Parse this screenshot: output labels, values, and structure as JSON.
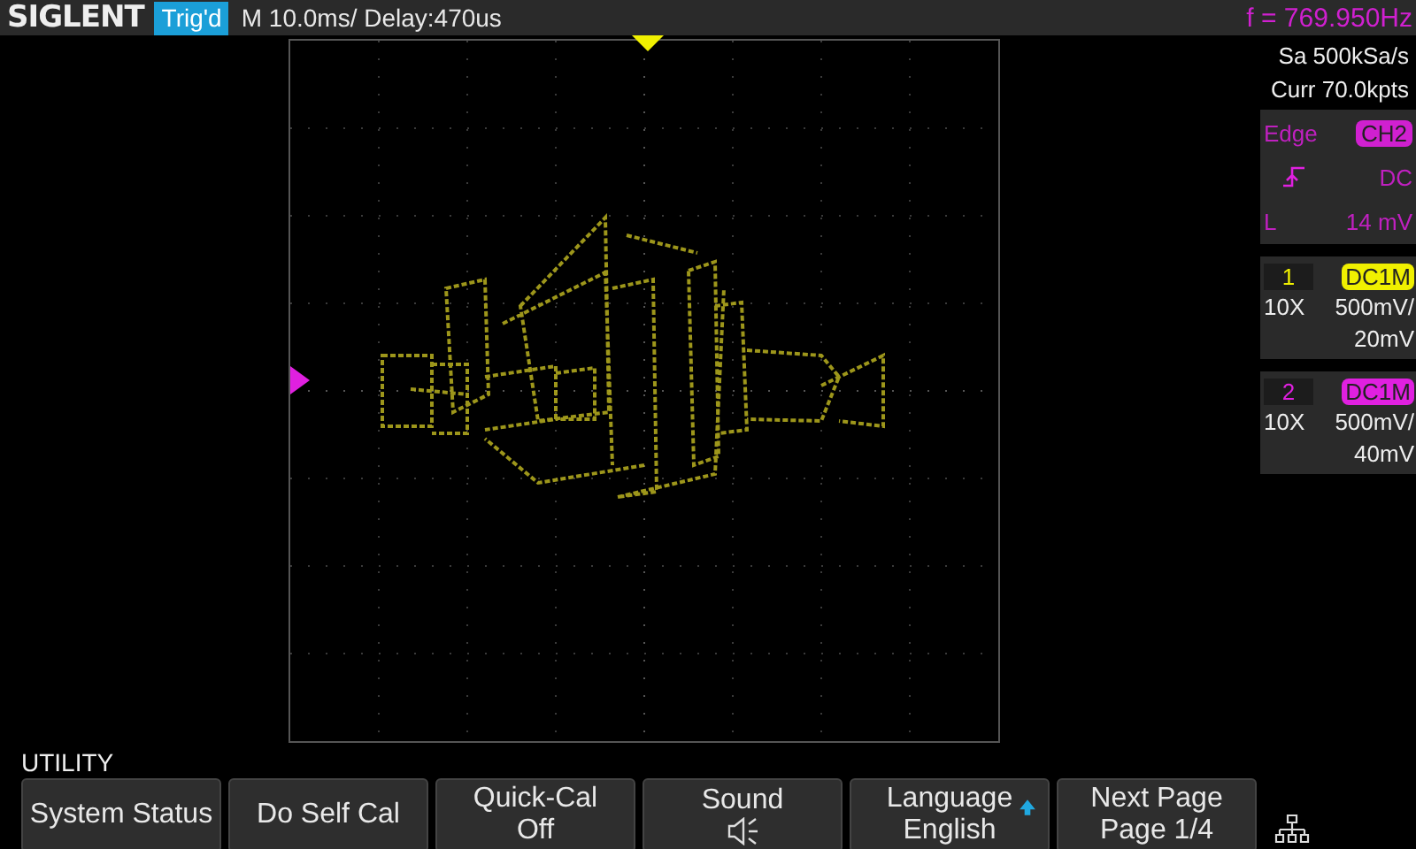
{
  "top_bar": {
    "logo": "SIGLENT",
    "trigger_status": "Trig'd",
    "timebase": "M 10.0ms/ Delay:470us",
    "frequency": "f = 769.950Hz"
  },
  "acquisition": {
    "sample_rate": "Sa 500kSa/s",
    "memory_depth": "Curr 70.0kpts"
  },
  "trigger": {
    "type": "Edge",
    "source": "CH2",
    "coupling": "DC",
    "level_label": "L",
    "level": "14 mV"
  },
  "channels": [
    {
      "number": "1",
      "coupling": "DC1M",
      "probe": "10X",
      "scale": "500mV/",
      "offset": "20mV",
      "color": "#f0f000"
    },
    {
      "number": "2",
      "coupling": "DC1M",
      "probe": "10X",
      "scale": "500mV/",
      "offset": "40mV",
      "color": "#e020e0"
    }
  ],
  "menu": {
    "title": "UTILITY",
    "softkeys": [
      {
        "kind": "plain",
        "label": "System Status"
      },
      {
        "kind": "plain",
        "label": "Do Self Cal"
      },
      {
        "kind": "value",
        "label": "Quick-Cal",
        "value": "Off"
      },
      {
        "kind": "sound",
        "label": "Sound"
      },
      {
        "kind": "value_up",
        "label": "Language",
        "value": "English"
      },
      {
        "kind": "value",
        "label": "Next Page",
        "value": "Page 1/4"
      },
      {
        "kind": "network"
      }
    ]
  }
}
